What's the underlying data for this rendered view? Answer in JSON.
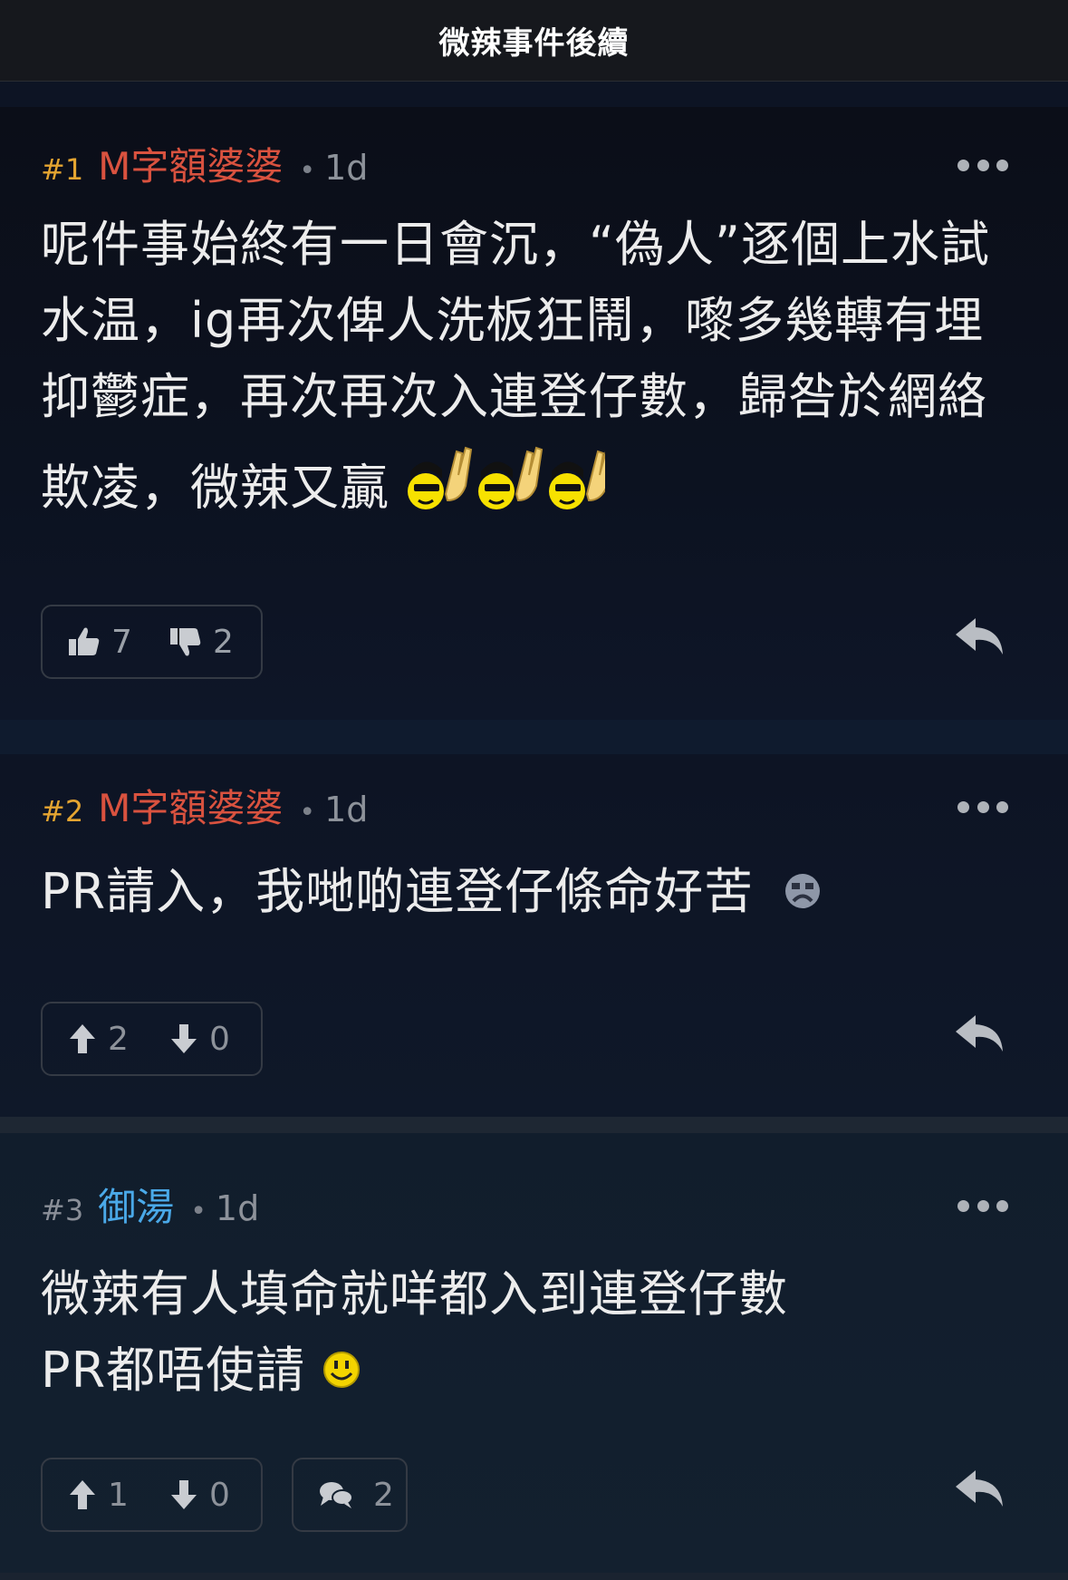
{
  "header": {
    "title": "微辣事件後續"
  },
  "posts": [
    {
      "floor": "#1",
      "user": "M字額婆婆",
      "time": "1d",
      "content_lines": [
        "呢件事始終有一日會沉，“偽人”逐個上水試",
        "水温，ig再次俾人洗板狂鬧，嚟多幾轉有埋",
        "抑鬱症，再次再次入連登仔數，歸咎於網絡",
        "欺凌，微辣又贏"
      ],
      "likes": "7",
      "dislikes": "2",
      "vote_style": "thumbs"
    },
    {
      "floor": "#2",
      "user": "M字額婆婆",
      "time": "1d",
      "content_lines": [
        "PR請入，我哋啲連登仔條命好苦"
      ],
      "likes": "2",
      "dislikes": "0",
      "vote_style": "arrows"
    },
    {
      "floor": "#3",
      "user": "御湯",
      "time": "1d",
      "content_lines": [
        "微辣有人填命就咩都入到連登仔數",
        "PR都唔使請"
      ],
      "likes": "1",
      "dislikes": "0",
      "comments": "2",
      "vote_style": "arrows"
    }
  ],
  "icons": {
    "more": "more-horizontal-icon",
    "reply": "reply-arrow-icon",
    "like": "thumbs-up-icon",
    "dislike": "thumbs-down-icon",
    "up": "arrow-up-icon",
    "down": "arrow-down-icon",
    "comment": "speech-bubble-icon"
  },
  "colors": {
    "floor_gold": "#e5a531",
    "user_red": "#d9523f",
    "user_blue": "#4aa9e8",
    "background": "#0b0f1a"
  }
}
